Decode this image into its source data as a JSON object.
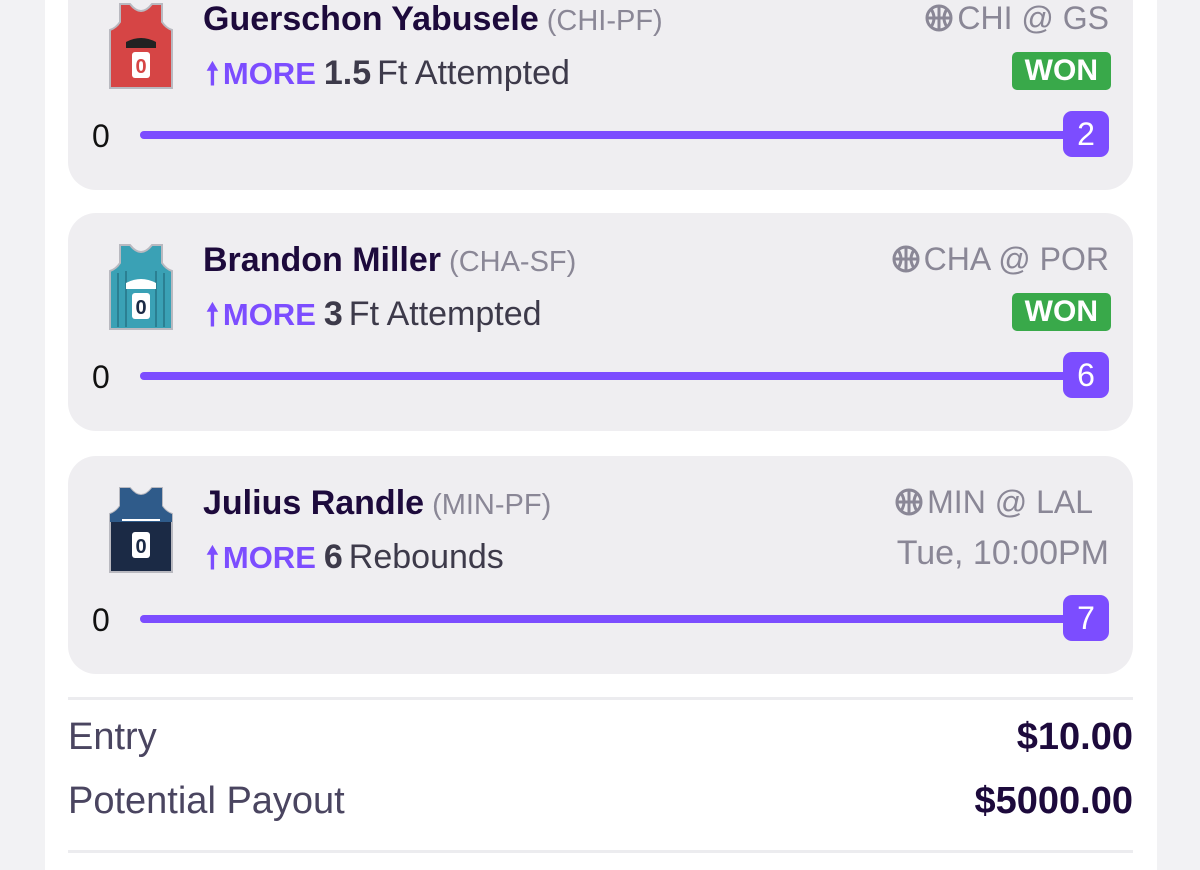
{
  "picks": [
    {
      "player": "Guerschon Yabusele",
      "team_pos": "(CHI-PF)",
      "direction_label": "MORE",
      "line": "1.5",
      "stat": "Ft Attempted",
      "matchup": "CHI @ GS",
      "status": "WON",
      "progress_min": "0",
      "progress_value": "2",
      "progress_fraction": 1.0,
      "jersey_color": "#d64545",
      "jersey_number": "0"
    },
    {
      "player": "Brandon Miller",
      "team_pos": "(CHA-SF)",
      "direction_label": "MORE",
      "line": "3",
      "stat": "Ft Attempted",
      "matchup": "CHA @ POR",
      "status": "WON",
      "progress_min": "0",
      "progress_value": "6",
      "progress_fraction": 1.0,
      "jersey_color": "#3aa1b5",
      "jersey_number": "0"
    },
    {
      "player": "Julius Randle",
      "team_pos": "(MIN-PF)",
      "direction_label": "MORE",
      "line": "6",
      "stat": "Rebounds",
      "matchup": "MIN @ LAL",
      "game_time": "Tue, 10:00PM",
      "progress_min": "0",
      "progress_value": "7",
      "progress_fraction": 1.0,
      "jersey_color": "#1b2a45",
      "jersey_number": "0"
    }
  ],
  "summary": {
    "entry_label": "Entry",
    "entry_value": "$10.00",
    "payout_label": "Potential Payout",
    "payout_value": "$5000.00"
  },
  "colors": {
    "accent": "#7c4dff",
    "won": "#39a94a"
  },
  "icons": {
    "arrow": "arrow-up-icon",
    "sport": "basketball-icon",
    "player": "jersey-icon"
  }
}
